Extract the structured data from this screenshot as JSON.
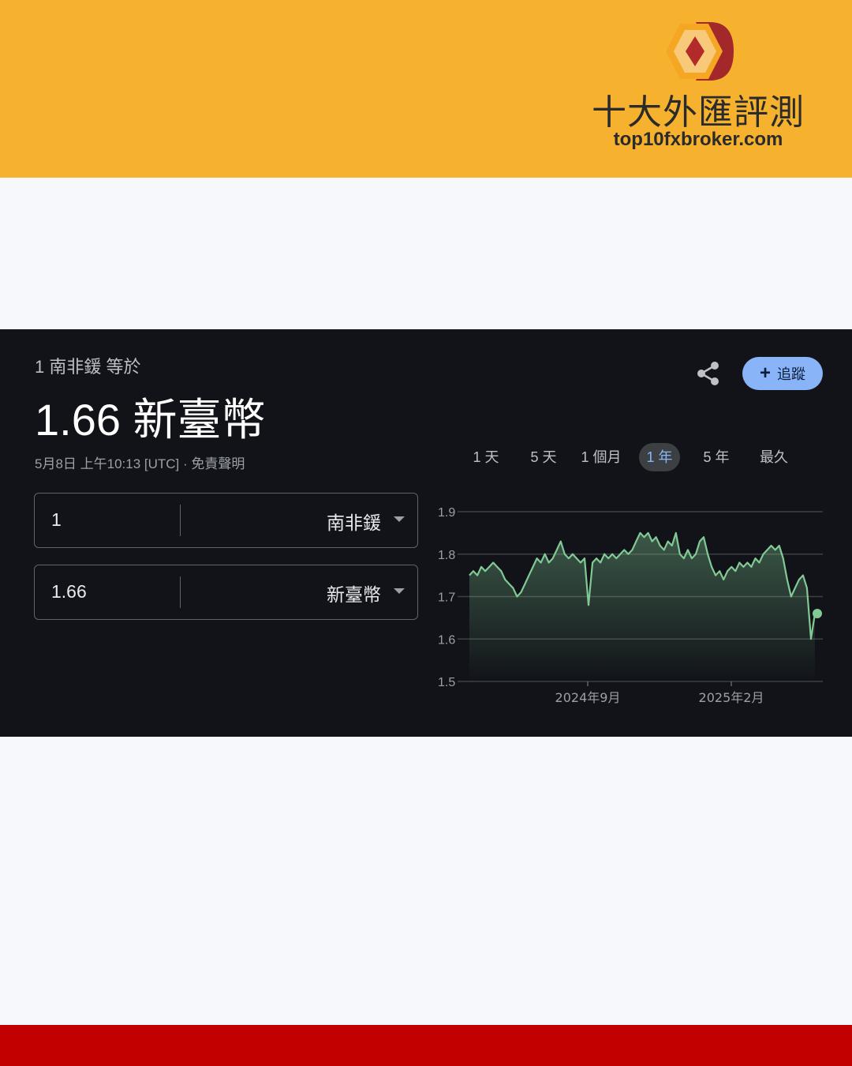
{
  "brand": {
    "name": "十大外匯評測",
    "url": "top10fxbroker.com"
  },
  "widget": {
    "equals_label": "1 南非鍰 等於",
    "result": "1.66 新臺幣",
    "timestamp": "5月8日 上午10:13 [UTC] · 免責聲明",
    "follow_label": "追蹤",
    "from": {
      "amount": "1",
      "currency": "南非鍰"
    },
    "to": {
      "amount": "1.66",
      "currency": "新臺幣"
    },
    "ranges": [
      "1 天",
      "5 天",
      "1 個月",
      "1 年",
      "5 年",
      "最久"
    ],
    "active_range": "1 年"
  },
  "colors": {
    "header": "#f6b22e",
    "widget_bg": "#111318",
    "line": "#81c995",
    "accent": "#8ab4f8",
    "footer": "#c20000"
  },
  "chart_data": {
    "type": "area",
    "x_ticks": [
      "2024年9月",
      "2025年2月"
    ],
    "y_ticks": [
      1.9,
      1.8,
      1.7,
      1.6,
      1.5
    ],
    "ylim": [
      1.5,
      1.9
    ],
    "grid": true,
    "values": [
      1.75,
      1.76,
      1.75,
      1.77,
      1.76,
      1.77,
      1.78,
      1.77,
      1.76,
      1.74,
      1.73,
      1.72,
      1.7,
      1.71,
      1.73,
      1.75,
      1.77,
      1.79,
      1.78,
      1.8,
      1.78,
      1.79,
      1.81,
      1.83,
      1.8,
      1.79,
      1.8,
      1.79,
      1.78,
      1.79,
      1.68,
      1.78,
      1.79,
      1.78,
      1.8,
      1.79,
      1.8,
      1.79,
      1.8,
      1.81,
      1.8,
      1.81,
      1.83,
      1.85,
      1.84,
      1.85,
      1.83,
      1.84,
      1.82,
      1.81,
      1.83,
      1.82,
      1.85,
      1.8,
      1.79,
      1.81,
      1.79,
      1.8,
      1.83,
      1.84,
      1.8,
      1.77,
      1.75,
      1.76,
      1.74,
      1.76,
      1.77,
      1.76,
      1.78,
      1.77,
      1.78,
      1.77,
      1.79,
      1.78,
      1.8,
      1.81,
      1.82,
      1.81,
      1.82,
      1.79,
      1.74,
      1.7,
      1.72,
      1.74,
      1.75,
      1.72,
      1.6,
      1.66
    ]
  }
}
